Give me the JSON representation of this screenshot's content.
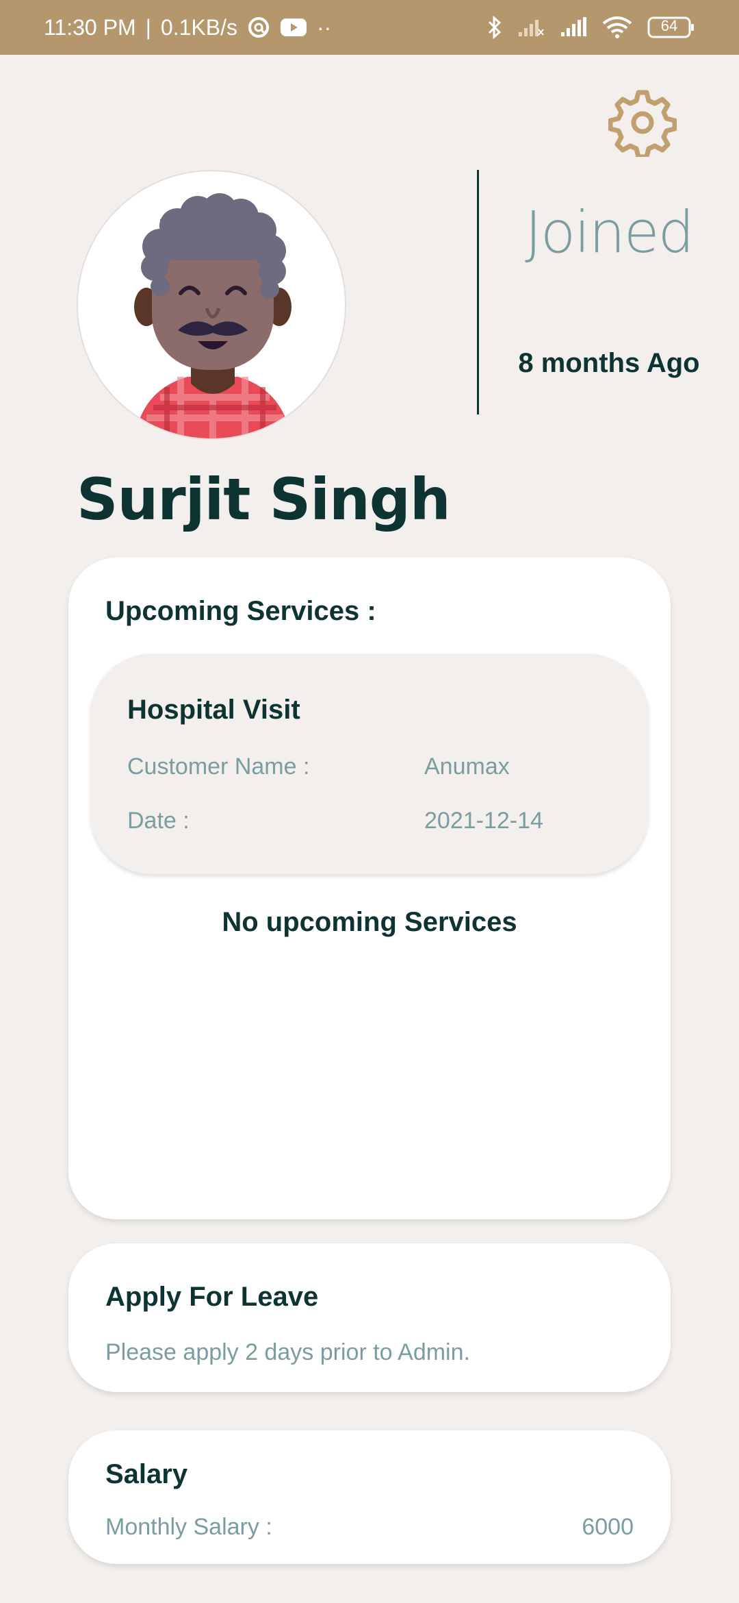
{
  "status_bar": {
    "time": "11:30 PM",
    "separator": "|",
    "speed": "0.1KB/s",
    "more": "··",
    "battery": "64"
  },
  "profile": {
    "name": "Surjit Singh",
    "joined_label": "Joined",
    "joined_value": "8 months Ago"
  },
  "upcoming": {
    "title": "Upcoming Services :",
    "service": {
      "title": "Hospital Visit",
      "customer_label": "Customer Name :",
      "customer_value": "Anumax",
      "date_label": "Date :",
      "date_value": "2021-12-14"
    },
    "empty_text": "No upcoming Services"
  },
  "leave": {
    "title": "Apply For Leave",
    "subtitle": "Please apply 2 days prior to Admin."
  },
  "salary": {
    "title": "Salary",
    "label": "Monthly Salary :",
    "value": "6000"
  },
  "colors": {
    "status_bar": "#b5976d",
    "accent_gold": "#c29f6e",
    "text_dark": "#0e3333",
    "text_muted": "#7b9ca0",
    "background": "#f2efec"
  },
  "icons": {
    "settings": "gear-icon",
    "avatar": "avatar-illustration"
  }
}
